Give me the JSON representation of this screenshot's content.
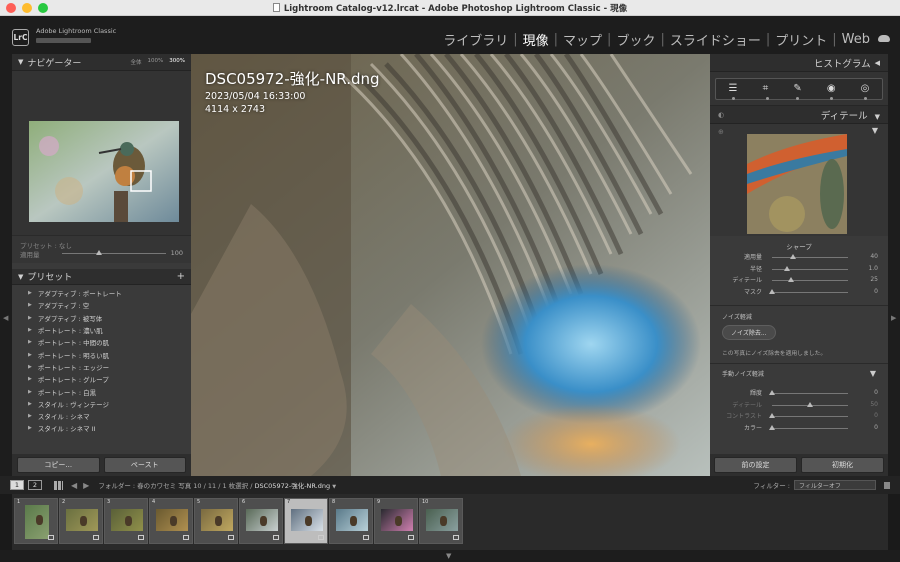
{
  "window": {
    "title": "Lightroom Catalog-v12.lrcat - Adobe Photoshop Lightroom Classic - 現像"
  },
  "identity": {
    "logo": "LrC",
    "app_name": "Adobe Lightroom Classic"
  },
  "modules": [
    {
      "label": "ライブラリ",
      "active": false
    },
    {
      "label": "現像",
      "active": true
    },
    {
      "label": "マップ",
      "active": false
    },
    {
      "label": "ブック",
      "active": false
    },
    {
      "label": "スライドショー",
      "active": false
    },
    {
      "label": "プリント",
      "active": false
    },
    {
      "label": "Web",
      "active": false
    }
  ],
  "navigator": {
    "title": "ナビゲーター",
    "zoom_options": [
      "全体",
      "100%",
      "300%"
    ],
    "zoom_selected": "300%"
  },
  "preset_amount": {
    "preset_label": "プリセット : なし",
    "amount_label": "適用量",
    "amount_value": "100"
  },
  "presets": {
    "title": "プリセット",
    "add": "+",
    "items": [
      "アダプティブ : ポートレート",
      "アダプティブ : 空",
      "アダプティブ : 被写体",
      "ポートレート : 濃い肌",
      "ポートレート : 中間の肌",
      "ポートレート : 明るい肌",
      "ポートレート : エッジー",
      "ポートレート : グループ",
      "ポートレート : 白黒",
      "スタイル : ヴィンテージ",
      "スタイル : シネマ",
      "スタイル : シネマ II"
    ]
  },
  "left_buttons": {
    "copy": "コピー...",
    "paste": "ペースト"
  },
  "photo_info": {
    "filename": "DSC05972-強化-NR.dng",
    "datetime": "2023/05/04 16:33:00",
    "dimensions": "4114 x 2743"
  },
  "histogram": {
    "title": "ヒストグラム"
  },
  "detail": {
    "title": "ディテール",
    "sharpening_title": "シャープ",
    "sharpening": [
      {
        "label": "適用量",
        "value": "40",
        "pos": 0.27
      },
      {
        "label": "半径",
        "value": "1.0",
        "pos": 0.2
      },
      {
        "label": "ディテール",
        "value": "25",
        "pos": 0.25
      },
      {
        "label": "マスク",
        "value": "0",
        "pos": 0.0
      }
    ],
    "noise_title": "ノイズ軽減",
    "denoise_button": "ノイズ除去...",
    "denoise_message": "この写真にノイズ除去を適用しました。",
    "manual_title": "手動ノイズ軽減",
    "manual": [
      {
        "label": "輝度",
        "value": "0",
        "pos": 0.0,
        "dim": false
      },
      {
        "label": "ディテール",
        "value": "50",
        "pos": 0.5,
        "dim": true
      },
      {
        "label": "コントラスト",
        "value": "0",
        "pos": 0.0,
        "dim": true
      },
      {
        "label": "カラー",
        "value": "0",
        "pos": 0.0,
        "dim": false
      }
    ]
  },
  "right_buttons": {
    "previous": "前の設定",
    "reset": "初期化"
  },
  "filmstrip_bar": {
    "screen1": "1",
    "screen2": "2",
    "breadcrumb_prefix": "フォルダー : 春のカワセミ   写真 10 / 11 / 1 枚選択 /",
    "current_file": "DSC05972-強化-NR.dng",
    "filter_label": "フィルター :",
    "filter_value": "フィルターオフ"
  },
  "filmstrip": [
    {
      "num": "1",
      "selected": false,
      "tall": true
    },
    {
      "num": "2",
      "selected": false,
      "tall": false
    },
    {
      "num": "3",
      "selected": false,
      "tall": false
    },
    {
      "num": "4",
      "selected": false,
      "tall": false
    },
    {
      "num": "5",
      "selected": false,
      "tall": false
    },
    {
      "num": "6",
      "selected": false,
      "tall": false
    },
    {
      "num": "7",
      "selected": true,
      "tall": false
    },
    {
      "num": "8",
      "selected": false,
      "tall": false
    },
    {
      "num": "9",
      "selected": false,
      "tall": false
    },
    {
      "num": "10",
      "selected": false,
      "tall": false
    }
  ]
}
